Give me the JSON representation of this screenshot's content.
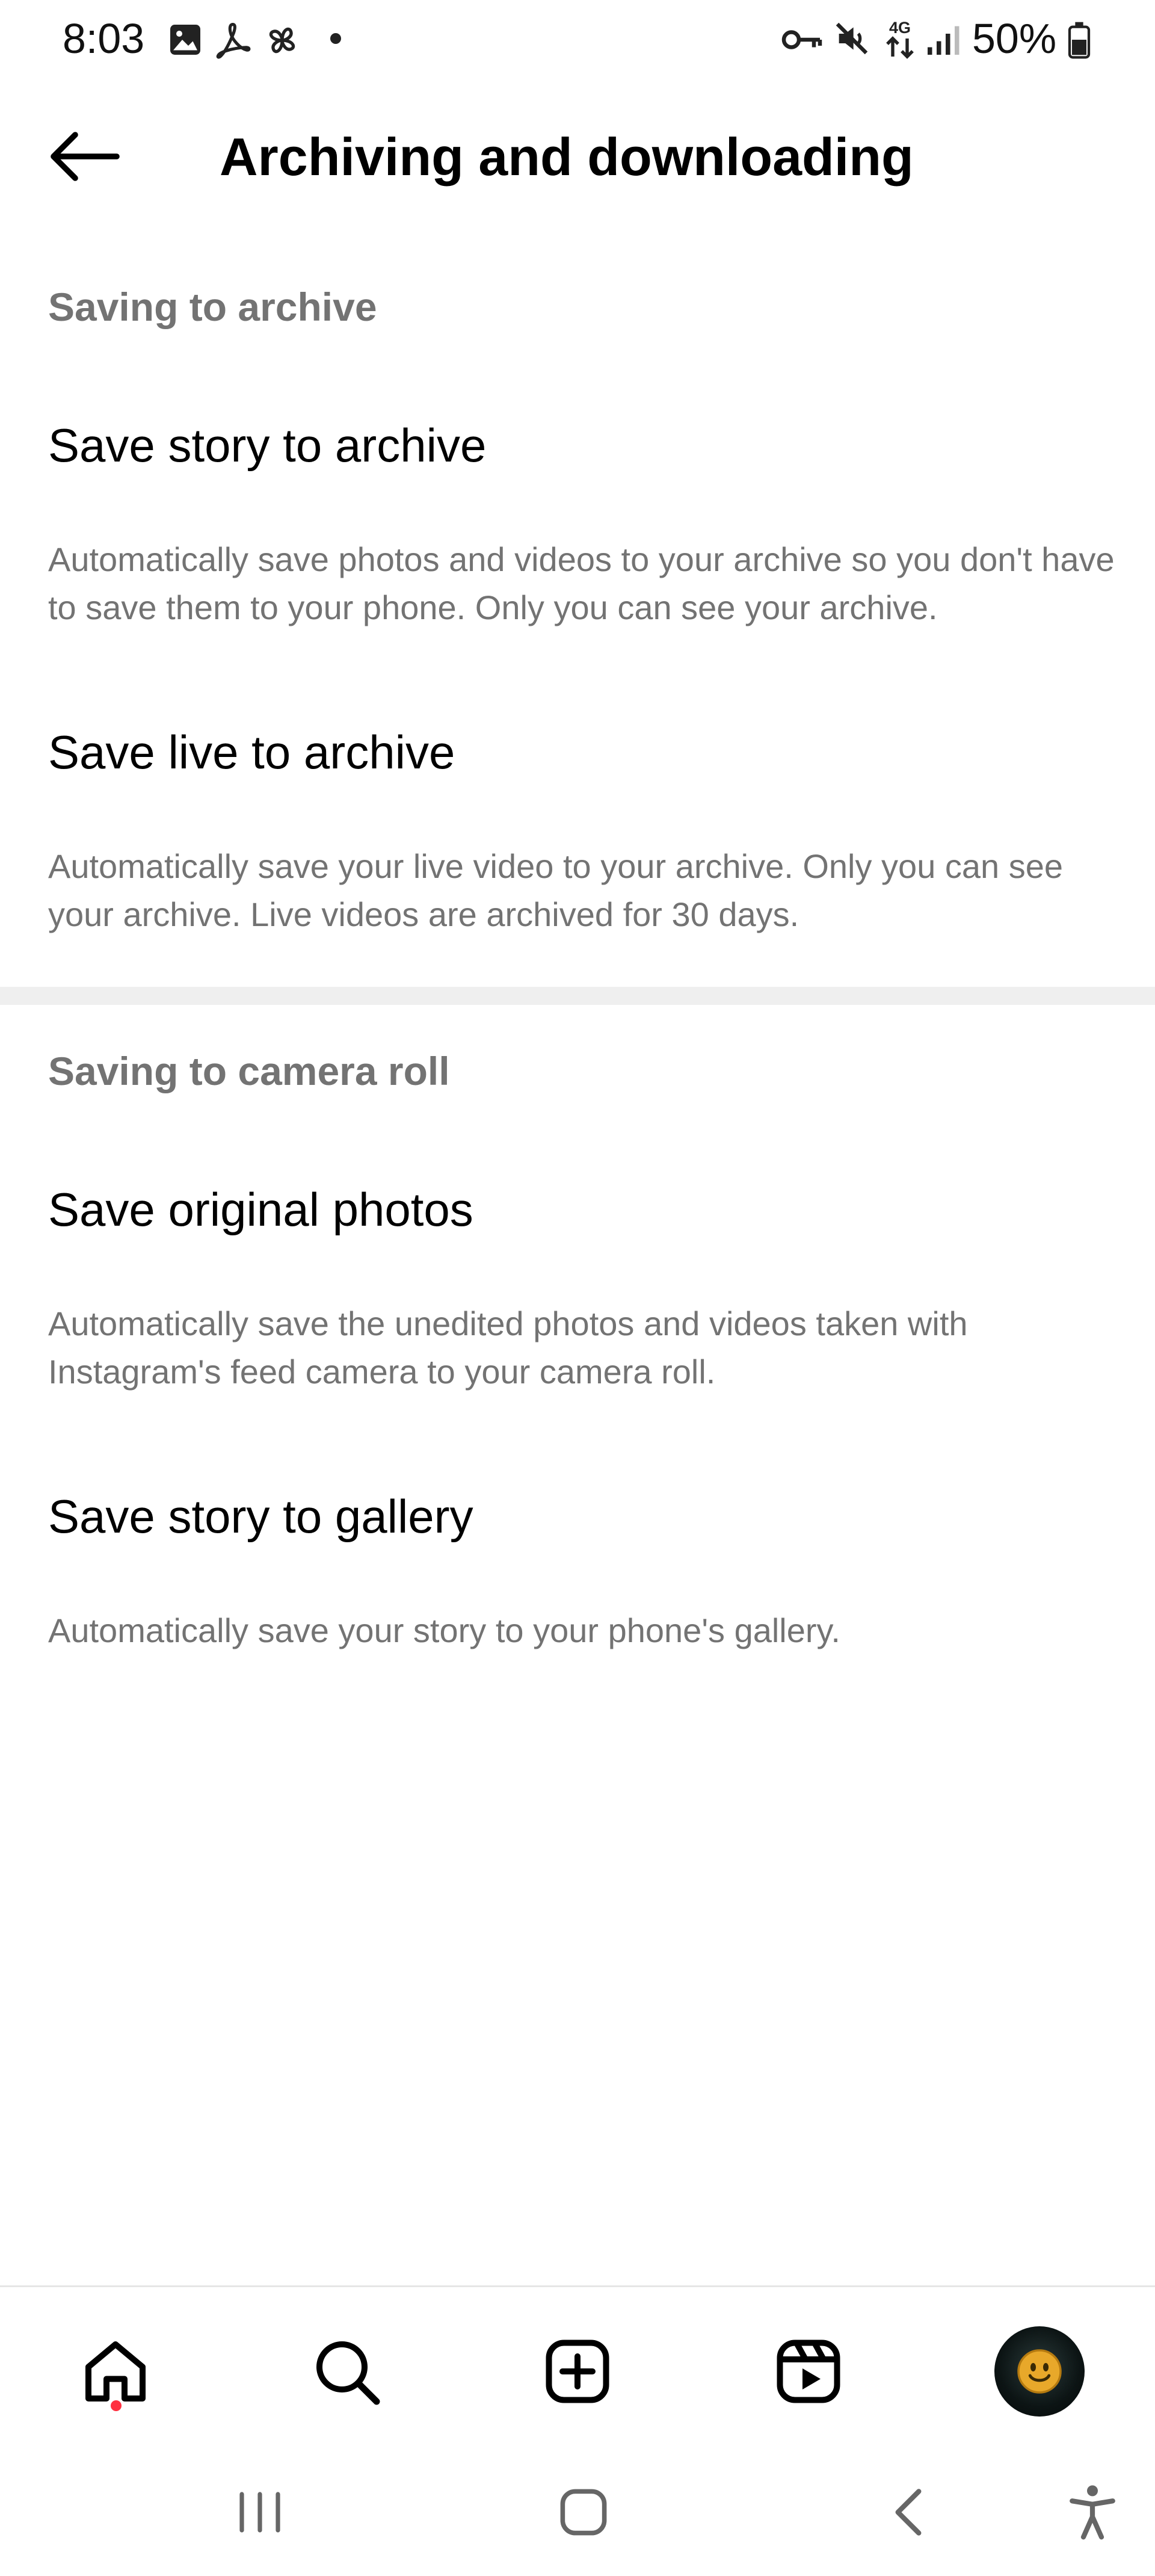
{
  "status_bar": {
    "time": "8:03",
    "battery": "50%",
    "network": "4G",
    "left_icons": [
      "gallery-icon",
      "acrobat-icon",
      "pinwheel-icon",
      "notification-dot-icon"
    ],
    "right_icons": [
      "vpn-key-icon",
      "mute-icon",
      "4g-data-icon",
      "signal-icon",
      "battery-icon"
    ]
  },
  "header": {
    "back_icon": "back-arrow-icon",
    "title": "Archiving and downloading"
  },
  "sections": [
    {
      "header": "Saving to archive",
      "items": [
        {
          "title": "Save story to archive",
          "description": "Automatically save photos and videos to your archive so you don't have to save them to your phone. Only you can see your archive."
        },
        {
          "title": "Save live to archive",
          "description": "Automatically save your live video to your archive. Only you can see your archive. Live videos are archived for 30 days."
        }
      ]
    },
    {
      "header": "Saving to camera roll",
      "items": [
        {
          "title": "Save original photos",
          "description": "Automatically save the unedited photos and videos taken with Instagram's feed camera to your camera roll."
        },
        {
          "title": "Save story to gallery",
          "description": "Automatically save your story to your phone's gallery."
        }
      ]
    }
  ],
  "bottom_nav": {
    "items": [
      "home-icon",
      "search-icon",
      "create-icon",
      "reels-icon",
      "profile-avatar"
    ],
    "active": "home-icon",
    "notification_color": "#ff3040"
  },
  "system_nav": {
    "items": [
      "recents-icon",
      "home-button-icon",
      "back-icon",
      "accessibility-icon"
    ]
  },
  "colors": {
    "primary_text": "#000000",
    "secondary_text": "#737373",
    "divider": "#efefef",
    "background": "#ffffff"
  }
}
